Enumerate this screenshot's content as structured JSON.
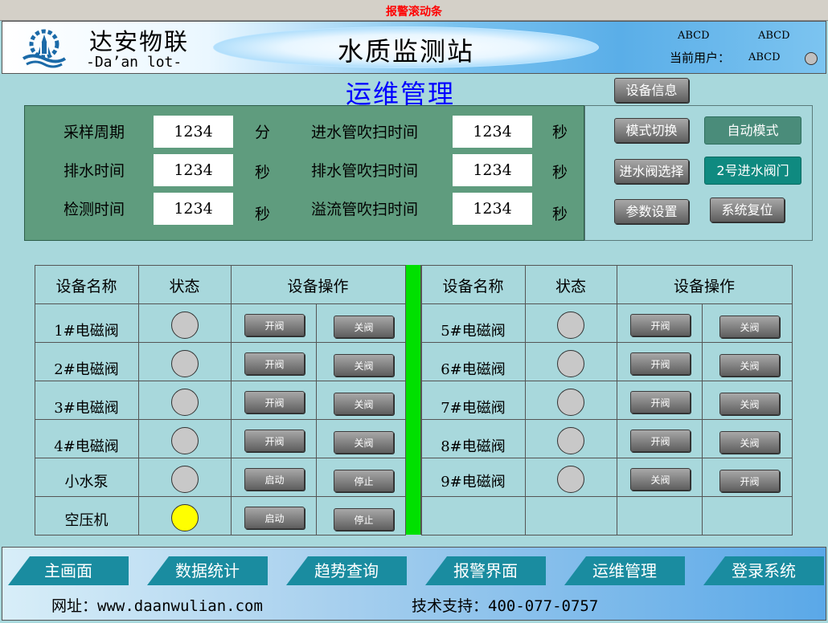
{
  "alarm_banner": "报警滚动条",
  "header": {
    "brand_cn": "达安物联",
    "brand_en": "-Da’an lot-",
    "station_title": "水质监测站",
    "top_label_1": "ABCD",
    "top_label_2": "ABCD",
    "current_user_label": "当前用户：",
    "current_user_value": "ABCD"
  },
  "page_title": "运维管理",
  "device_info_button": "设备信息",
  "params": {
    "sampling_period": {
      "label": "采样周期",
      "value": "1234",
      "unit": "分"
    },
    "drain_time": {
      "label": "排水时间",
      "value": "1234",
      "unit": "秒"
    },
    "detect_time": {
      "label": "检测时间",
      "value": "1234",
      "unit": "秒"
    },
    "inlet_purge": {
      "label": "进水管吹扫时间",
      "value": "1234",
      "unit": "秒"
    },
    "drain_purge": {
      "label": "排水管吹扫时间",
      "value": "1234",
      "unit": "秒"
    },
    "overflow_purge": {
      "label": "溢流管吹扫时间",
      "value": "1234",
      "unit": "秒"
    }
  },
  "controls": {
    "mode_switch": "模式切换",
    "mode_value": "自动模式",
    "inlet_valve_select": "进水阀选择",
    "inlet_valve_value": "2号进水阀门",
    "param_settings": "参数设置",
    "system_reset": "系统复位"
  },
  "table": {
    "headers": {
      "name": "设备名称",
      "status": "状态",
      "operation": "设备操作"
    },
    "left_rows": [
      {
        "name": "1#电磁阀",
        "status": "off",
        "btn1": "开阀",
        "btn2": "关阀"
      },
      {
        "name": "2#电磁阀",
        "status": "off",
        "btn1": "开阀",
        "btn2": "关阀"
      },
      {
        "name": "3#电磁阀",
        "status": "off",
        "btn1": "开阀",
        "btn2": "关阀"
      },
      {
        "name": "4#电磁阀",
        "status": "off",
        "btn1": "开阀",
        "btn2": "关阀"
      },
      {
        "name": "小水泵",
        "status": "off",
        "btn1": "启动",
        "btn2": "停止"
      },
      {
        "name": "空压机",
        "status": "on",
        "btn1": "启动",
        "btn2": "停止"
      }
    ],
    "right_rows": [
      {
        "name": "5#电磁阀",
        "status": "off",
        "btn1": "开阀",
        "btn2": "关阀"
      },
      {
        "name": "6#电磁阀",
        "status": "off",
        "btn1": "开阀",
        "btn2": "关阀"
      },
      {
        "name": "7#电磁阀",
        "status": "off",
        "btn1": "开阀",
        "btn2": "关阀"
      },
      {
        "name": "8#电磁阀",
        "status": "off",
        "btn1": "开阀",
        "btn2": "关阀"
      },
      {
        "name": "9#电磁阀",
        "status": "off",
        "btn1": "关阀",
        "btn2": "开阀"
      }
    ]
  },
  "nav": [
    "主画面",
    "数据统计",
    "趋势查询",
    "报警界面",
    "运维管理",
    "登录系统"
  ],
  "footer": {
    "website": "网址：www.daanwulian.com",
    "support": "技术支持：400-077-0757"
  },
  "colors": {
    "background": "#a8d8dc",
    "param_panel": "#5f9c7e",
    "divider": "#00e000",
    "nav_button": "#1a8ca0",
    "lamp_on": "#ffff00",
    "lamp_off": "#c8c8c8",
    "page_title": "#0000ff",
    "alarm_text": "#ff0000"
  }
}
